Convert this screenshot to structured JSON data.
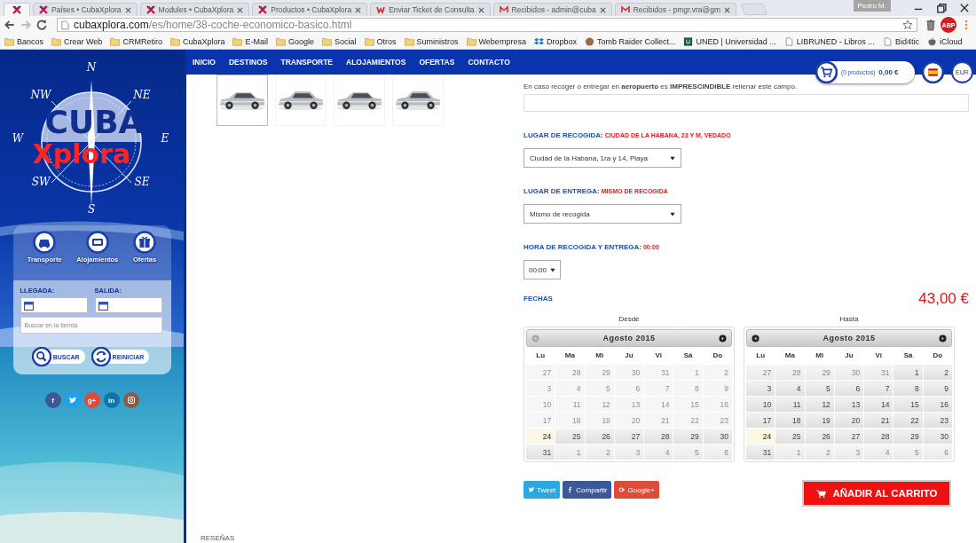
{
  "browser": {
    "tabs": [
      {
        "kind": "x",
        "selected": true
      },
      {
        "kind": "x",
        "title": "Países • CubaXplora",
        "selected": false
      },
      {
        "kind": "x",
        "title": "Modules • CubaXplora",
        "selected": false
      },
      {
        "kind": "x",
        "title": "Productos • CubaXplora",
        "selected": false
      },
      {
        "kind": "w",
        "title": "Enviar Ticket de Consulta",
        "selected": false
      },
      {
        "kind": "mail",
        "title": "Recibidos - admin@cuba",
        "selected": false
      },
      {
        "kind": "mail",
        "title": "Recibidos - pmgr.vra@gm",
        "selected": false
      }
    ],
    "user": "Pedro M.",
    "url_domain": "cubaxplora.com",
    "url_path": "/es/home/38-coche-economico-basico.html",
    "extension": "ABP",
    "bookmarks": [
      {
        "kind": "folder",
        "label": "Bancos"
      },
      {
        "kind": "folder",
        "label": "Crear Web"
      },
      {
        "kind": "folder",
        "label": "CRMRetiro"
      },
      {
        "kind": "folder",
        "label": "CubaXplora"
      },
      {
        "kind": "folder",
        "label": "E-Mail"
      },
      {
        "kind": "folder",
        "label": "Google"
      },
      {
        "kind": "folder",
        "label": "Social"
      },
      {
        "kind": "folder",
        "label": "Otros"
      },
      {
        "kind": "folder",
        "label": "Suministros"
      },
      {
        "kind": "folder",
        "label": "Webempresa"
      },
      {
        "kind": "dropbox",
        "label": "Dropbox"
      },
      {
        "kind": "avatar",
        "label": "Tomb Raider Collect..."
      },
      {
        "kind": "logo",
        "label": "UNED | Universidad ..."
      },
      {
        "kind": "page",
        "label": "LIBRUNED - Libros ..."
      },
      {
        "kind": "page",
        "label": "Bid4tic"
      },
      {
        "kind": "apple",
        "label": "iCloud"
      }
    ]
  },
  "sidebar": {
    "logo": {
      "compass": [
        "N",
        "NE",
        "E",
        "SE",
        "S",
        "SW",
        "W",
        "NW"
      ],
      "title": "CUBA",
      "subtitle": "Xplora"
    },
    "categories": [
      {
        "kind": "car",
        "label": "Transporte"
      },
      {
        "kind": "bed",
        "label": "Alojamientos"
      },
      {
        "kind": "gift",
        "label": "Ofertas"
      }
    ],
    "arrival_label": "LLEGADA:",
    "departure_label": "SALIDA:",
    "search": {
      "placeholder": "Buscar en la tienda"
    },
    "buttons": [
      {
        "kind": "search",
        "label": "BUSCAR"
      },
      {
        "kind": "refresh",
        "label": "REINICIAR"
      }
    ],
    "social": [
      {
        "kind": "facebook",
        "label": "f",
        "color": "#3b5998"
      },
      {
        "kind": "twitter",
        "color": "#1da1f2"
      },
      {
        "kind": "google",
        "label": "g+",
        "color": "#dd4b39"
      },
      {
        "kind": "linkedin",
        "label": "in",
        "color": "#0e76a8"
      },
      {
        "kind": "instagram",
        "color": "#8a5a44"
      }
    ]
  },
  "main": {
    "nav": [
      "INICIO",
      "DESTINOS",
      "TRANSPORTE",
      "ALOJAMIENTOS",
      "OFERTAS",
      "CONTACTO"
    ],
    "cart": {
      "count": "(0 productos)",
      "total": "0,00 €"
    },
    "currency": "EUR",
    "thumbnails": [
      {
        "selected": true
      },
      {
        "selected": false
      },
      {
        "selected": false
      },
      {
        "selected": false
      }
    ],
    "note": "En caso recoger o entregar en **aeropuerto** es **IMPRESCINDIBLE** rellenar este campo.",
    "fields": [
      {
        "kind": "location",
        "label": "LUGAR DE RECOGIDA:",
        "value": "CIUDAD DE LA HABANA, 23 Y M, VEDADO",
        "select": "Ciudad de la Habana, 1ra y 14, Playa"
      },
      {
        "kind": "location",
        "label": "LUGAR DE ENTREGA:",
        "value": "MISMO DE RECOGIDA",
        "select": "Mismo de recogida"
      },
      {
        "kind": "time",
        "label": "HORA DE RECOGIDA Y ENTREGA:",
        "value": "00:00",
        "select": "00:00"
      }
    ],
    "dates_label": "FECHAS",
    "price": "43,00 €",
    "calendars": [
      {
        "label": "Desde",
        "month": "Agosto 2015",
        "prev_disabled": true,
        "weekdays": [
          "Lu",
          "Ma",
          "Mi",
          "Ju",
          "Vi",
          "Sá",
          "Do"
        ],
        "weeks": [
          [
            {
              "d": "27",
              "disabled": true,
              "other_month": false,
              "today": false
            },
            {
              "d": "28",
              "disabled": true,
              "other_month": false,
              "today": false
            },
            {
              "d": "29",
              "disabled": true,
              "other_month": false,
              "today": false
            },
            {
              "d": "30",
              "disabled": true,
              "other_month": false,
              "today": false
            },
            {
              "d": "31",
              "disabled": true,
              "other_month": false,
              "today": false
            },
            {
              "d": "1",
              "disabled": true,
              "other_month": false,
              "today": false
            },
            {
              "d": "2",
              "disabled": true,
              "other_month": false,
              "today": false
            }
          ],
          [
            {
              "d": "3",
              "disabled": true,
              "other_month": false,
              "today": false
            },
            {
              "d": "4",
              "disabled": true,
              "other_month": false,
              "today": false
            },
            {
              "d": "5",
              "disabled": true,
              "other_month": false,
              "today": false
            },
            {
              "d": "6",
              "disabled": true,
              "other_month": false,
              "today": false
            },
            {
              "d": "7",
              "disabled": true,
              "other_month": false,
              "today": false
            },
            {
              "d": "8",
              "disabled": true,
              "other_month": false,
              "today": false
            },
            {
              "d": "9",
              "disabled": true,
              "other_month": false,
              "today": false
            }
          ],
          [
            {
              "d": "10",
              "disabled": true,
              "other_month": false,
              "today": false
            },
            {
              "d": "11",
              "disabled": true,
              "other_month": false,
              "today": false
            },
            {
              "d": "12",
              "disabled": true,
              "other_month": false,
              "today": false
            },
            {
              "d": "13",
              "disabled": true,
              "other_month": false,
              "today": false
            },
            {
              "d": "14",
              "disabled": true,
              "other_month": false,
              "today": false
            },
            {
              "d": "15",
              "disabled": true,
              "other_month": false,
              "today": false
            },
            {
              "d": "16",
              "disabled": true,
              "other_month": false,
              "today": false
            }
          ],
          [
            {
              "d": "17",
              "disabled": true,
              "other_month": false,
              "today": false
            },
            {
              "d": "18",
              "disabled": true,
              "other_month": false,
              "today": false
            },
            {
              "d": "19",
              "disabled": true,
              "other_month": false,
              "today": false
            },
            {
              "d": "20",
              "disabled": true,
              "other_month": false,
              "today": false
            },
            {
              "d": "21",
              "disabled": true,
              "other_month": false,
              "today": false
            },
            {
              "d": "22",
              "disabled": true,
              "other_month": false,
              "today": false
            },
            {
              "d": "23",
              "disabled": true,
              "other_month": false,
              "today": false
            }
          ],
          [
            {
              "d": "24",
              "disabled": false,
              "other_month": false,
              "today": true
            },
            {
              "d": "25",
              "disabled": false,
              "other_month": false,
              "today": false
            },
            {
              "d": "26",
              "disabled": false,
              "other_month": false,
              "today": false
            },
            {
              "d": "27",
              "disabled": false,
              "other_month": false,
              "today": false
            },
            {
              "d": "28",
              "disabled": false,
              "other_month": false,
              "today": false
            },
            {
              "d": "29",
              "disabled": false,
              "other_month": false,
              "today": false
            },
            {
              "d": "30",
              "disabled": false,
              "other_month": false,
              "today": false
            }
          ],
          [
            {
              "d": "31",
              "disabled": false,
              "other_month": false,
              "today": false
            },
            {
              "d": "1",
              "disabled": false,
              "other_month": true,
              "today": false
            },
            {
              "d": "2",
              "disabled": false,
              "other_month": true,
              "today": false
            },
            {
              "d": "3",
              "disabled": false,
              "other_month": true,
              "today": false
            },
            {
              "d": "4",
              "disabled": false,
              "other_month": true,
              "today": false
            },
            {
              "d": "5",
              "disabled": false,
              "other_month": true,
              "today": false
            },
            {
              "d": "6",
              "disabled": false,
              "other_month": true,
              "today": false
            }
          ]
        ]
      },
      {
        "label": "Hasta",
        "month": "Agosto 2015",
        "prev_disabled": false,
        "weekdays": [
          "Lu",
          "Ma",
          "Mi",
          "Ju",
          "Vi",
          "Sá",
          "Do"
        ],
        "weeks": [
          [
            {
              "d": "27",
              "disabled": false,
              "other_month": true,
              "today": false
            },
            {
              "d": "28",
              "disabled": false,
              "other_month": true,
              "today": false
            },
            {
              "d": "29",
              "disabled": false,
              "other_month": true,
              "today": false
            },
            {
              "d": "30",
              "disabled": false,
              "other_month": true,
              "today": false
            },
            {
              "d": "31",
              "disabled": false,
              "other_month": true,
              "today": false
            },
            {
              "d": "1",
              "disabled": false,
              "other_month": false,
              "today": false
            },
            {
              "d": "2",
              "disabled": false,
              "other_month": false,
              "today": false
            }
          ],
          [
            {
              "d": "3",
              "disabled": false,
              "other_month": false,
              "today": false
            },
            {
              "d": "4",
              "disabled": false,
              "other_month": false,
              "today": false
            },
            {
              "d": "5",
              "disabled": false,
              "other_month": false,
              "today": false
            },
            {
              "d": "6",
              "disabled": false,
              "other_month": false,
              "today": false
            },
            {
              "d": "7",
              "disabled": false,
              "other_month": false,
              "today": false
            },
            {
              "d": "8",
              "disabled": false,
              "other_month": false,
              "today": false
            },
            {
              "d": "9",
              "disabled": false,
              "other_month": false,
              "today": false
            }
          ],
          [
            {
              "d": "10",
              "disabled": false,
              "other_month": false,
              "today": false
            },
            {
              "d": "11",
              "disabled": false,
              "other_month": false,
              "today": false
            },
            {
              "d": "12",
              "disabled": false,
              "other_month": false,
              "today": false
            },
            {
              "d": "13",
              "disabled": false,
              "other_month": false,
              "today": false
            },
            {
              "d": "14",
              "disabled": false,
              "other_month": false,
              "today": false
            },
            {
              "d": "15",
              "disabled": false,
              "other_month": false,
              "today": false
            },
            {
              "d": "16",
              "disabled": false,
              "other_month": false,
              "today": false
            }
          ],
          [
            {
              "d": "17",
              "disabled": false,
              "other_month": false,
              "today": false
            },
            {
              "d": "18",
              "disabled": false,
              "other_month": false,
              "today": false
            },
            {
              "d": "19",
              "disabled": false,
              "other_month": false,
              "today": false
            },
            {
              "d": "20",
              "disabled": false,
              "other_month": false,
              "today": false
            },
            {
              "d": "21",
              "disabled": false,
              "other_month": false,
              "today": false
            },
            {
              "d": "22",
              "disabled": false,
              "other_month": false,
              "today": false
            },
            {
              "d": "23",
              "disabled": false,
              "other_month": false,
              "today": false
            }
          ],
          [
            {
              "d": "24",
              "disabled": false,
              "other_month": false,
              "today": true
            },
            {
              "d": "25",
              "disabled": false,
              "other_month": false,
              "today": false
            },
            {
              "d": "26",
              "disabled": false,
              "other_month": false,
              "today": false
            },
            {
              "d": "27",
              "disabled": false,
              "other_month": false,
              "today": false
            },
            {
              "d": "28",
              "disabled": false,
              "other_month": false,
              "today": false
            },
            {
              "d": "29",
              "disabled": false,
              "other_month": false,
              "today": false
            },
            {
              "d": "30",
              "disabled": false,
              "other_month": false,
              "today": false
            }
          ],
          [
            {
              "d": "31",
              "disabled": false,
              "other_month": false,
              "today": false
            },
            {
              "d": "1",
              "disabled": false,
              "other_month": true,
              "today": false
            },
            {
              "d": "2",
              "disabled": false,
              "other_month": true,
              "today": false
            },
            {
              "d": "3",
              "disabled": false,
              "other_month": true,
              "today": false
            },
            {
              "d": "4",
              "disabled": false,
              "other_month": true,
              "today": false
            },
            {
              "d": "5",
              "disabled": false,
              "other_month": true,
              "today": false
            },
            {
              "d": "6",
              "disabled": false,
              "other_month": true,
              "today": false
            }
          ]
        ]
      }
    ],
    "share": [
      {
        "kind": "twitter",
        "label": "Tweet"
      },
      {
        "kind": "facebook",
        "label": "Compartir"
      },
      {
        "kind": "google",
        "label": "Google+"
      }
    ],
    "add_to_cart": "AÑADIR AL CARRITO",
    "reviews_heading": "RESEÑAS"
  }
}
